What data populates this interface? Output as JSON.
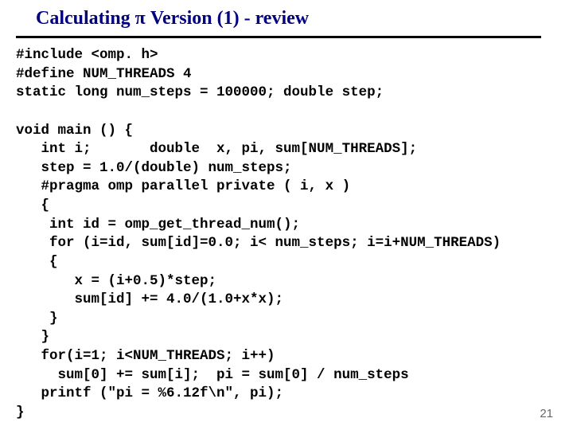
{
  "slide": {
    "title": "Calculating π Version (1) - review",
    "page_number": "21",
    "code": "#include <omp. h>\n#define NUM_THREADS 4\nstatic long num_steps = 100000; double step;\n\nvoid main () {\n   int i;       double  x, pi, sum[NUM_THREADS];\n   step = 1.0/(double) num_steps;\n   #pragma omp parallel private ( i, x )\n   {\n    int id = omp_get_thread_num();\n    for (i=id, sum[id]=0.0; i< num_steps; i=i+NUM_THREADS)\n    {\n       x = (i+0.5)*step;\n       sum[id] += 4.0/(1.0+x*x);\n    }\n   }\n   for(i=1; i<NUM_THREADS; i++)\n     sum[0] += sum[i];  pi = sum[0] / num_steps\n   printf (\"pi = %6.12f\\n\", pi);\n}"
  }
}
